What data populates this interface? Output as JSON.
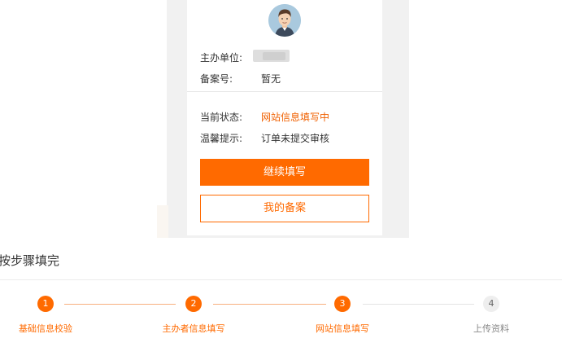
{
  "profile": {
    "sponsor_label": "主办单位:",
    "record_label": "备案号:",
    "record_value": "暂无"
  },
  "status": {
    "current_label": "当前状态:",
    "current_value": "网站信息填写中",
    "tip_label": "温馨提示:",
    "tip_value": "订单未提交审核"
  },
  "buttons": {
    "continue_label": "继续填写",
    "my_record_label": "我的备案"
  },
  "steps_section": {
    "title": "按步骤填完",
    "steps": [
      {
        "number": "1",
        "label": "基础信息校验",
        "state": "active"
      },
      {
        "number": "2",
        "label": "主办者信息填写",
        "state": "active"
      },
      {
        "number": "3",
        "label": "网站信息填写",
        "state": "active"
      },
      {
        "number": "4",
        "label": "上传资料",
        "state": "inactive"
      }
    ]
  },
  "colors": {
    "accent": "#ff6a00",
    "inactive": "#eeeeee"
  }
}
